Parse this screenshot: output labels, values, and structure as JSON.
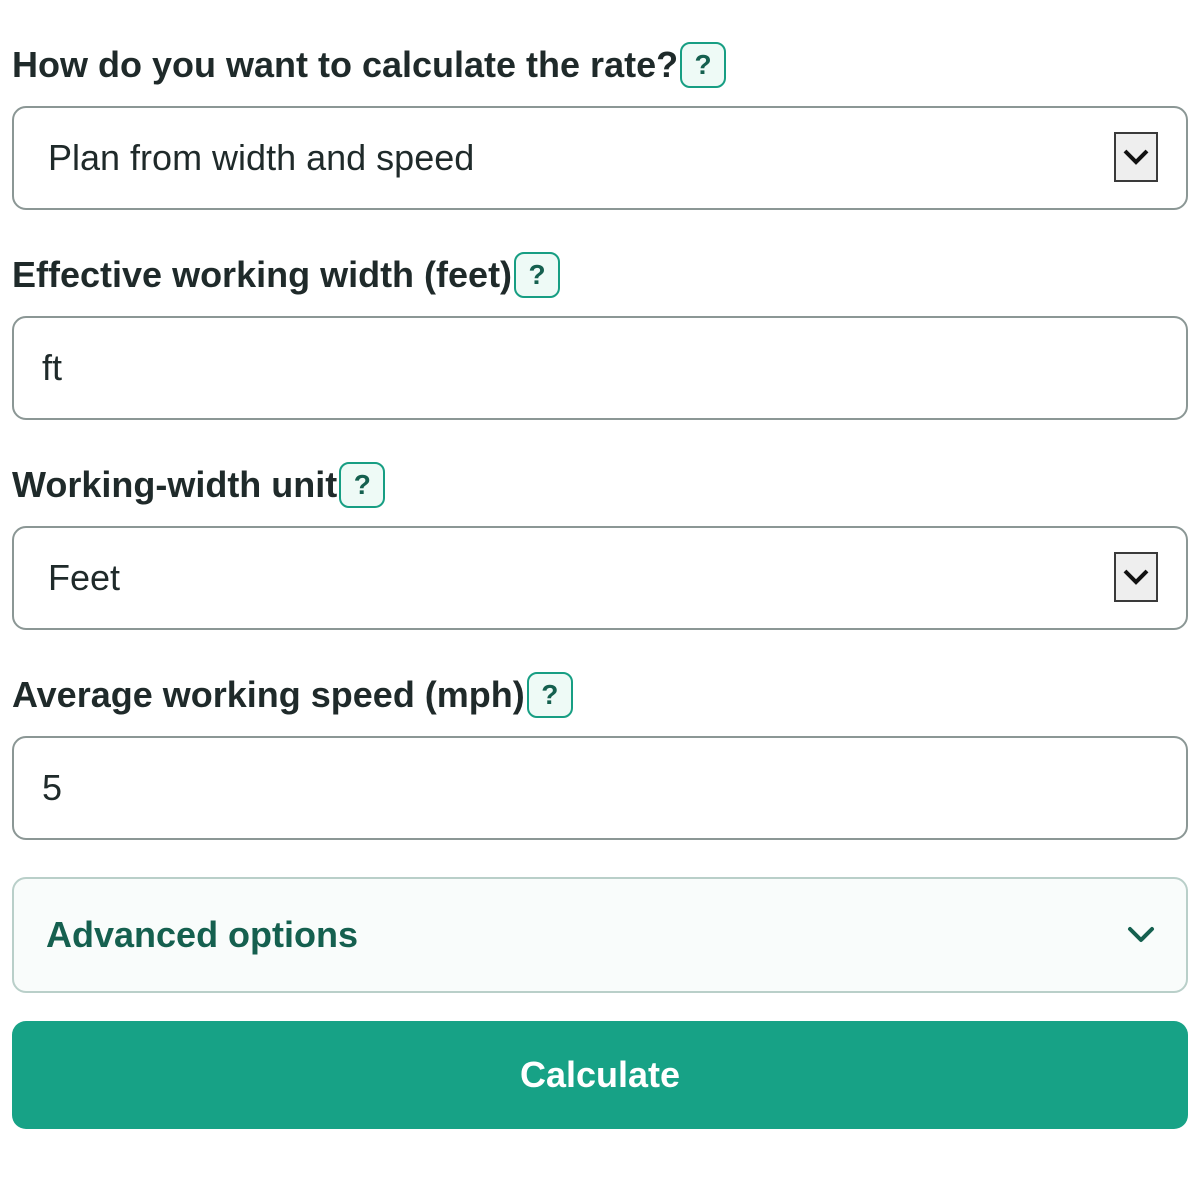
{
  "fields": {
    "method": {
      "label": "How do you want to calculate the rate?",
      "help": "?",
      "selected": "Plan from width and speed"
    },
    "width": {
      "label": "Effective working width (feet)",
      "help": "?",
      "value": "ft"
    },
    "width_unit": {
      "label": "Working-width unit",
      "help": "?",
      "selected": "Feet"
    },
    "speed": {
      "label": "Average working speed (mph)",
      "help": "?",
      "value": "5"
    }
  },
  "advanced": {
    "label": "Advanced options"
  },
  "calculate": {
    "label": "Calculate"
  },
  "icons": {
    "select_caret": "chevron-down-icon",
    "advanced_toggle": "chevron-down-icon"
  },
  "colors": {
    "accent": "#17a286",
    "accent_dark": "#15604f",
    "text": "#1f2a2a",
    "field_border": "#8b9795"
  }
}
